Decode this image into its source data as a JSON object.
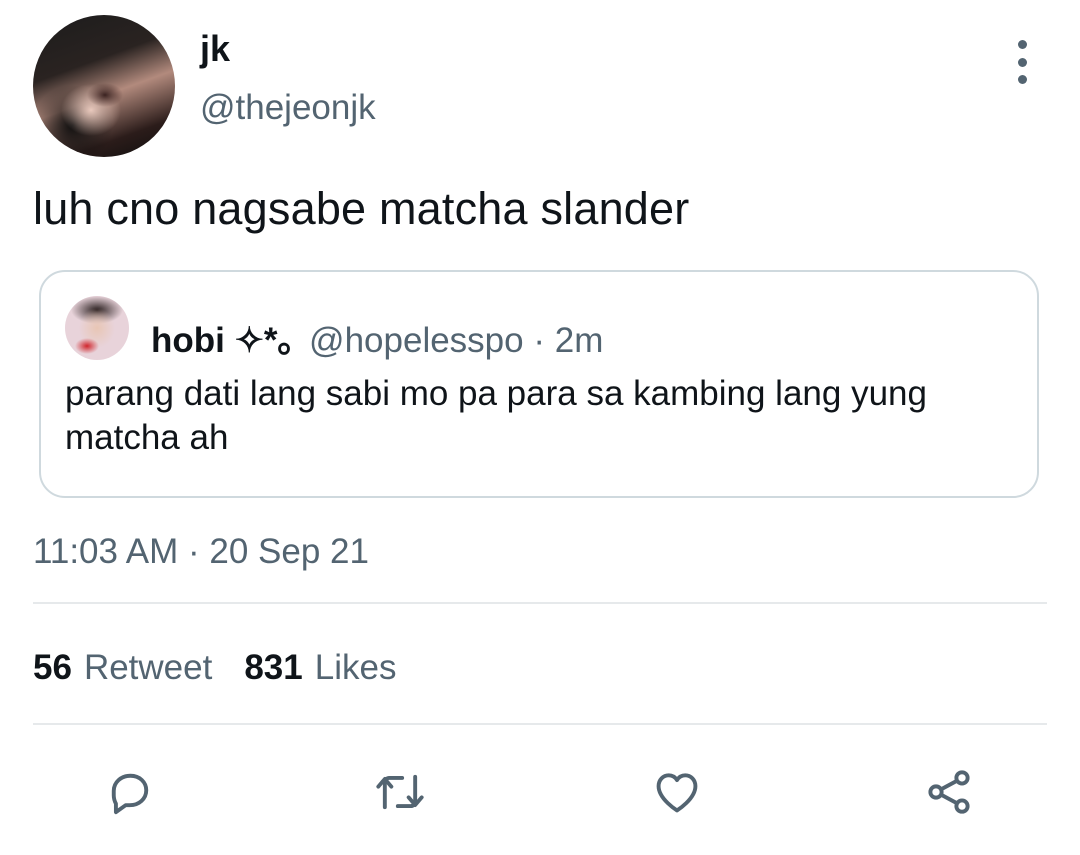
{
  "author": {
    "name": "jk",
    "handle": "@thejeonjk"
  },
  "tweet": {
    "text": "luh cno nagsabe matcha slander",
    "timestamp": "11:03 AM · 20 Sep 21"
  },
  "quoted_tweet": {
    "name": "hobi ✧*｡",
    "handle": "@hopelesspo",
    "time": " · 2m",
    "text": "parang dati lang sabi mo pa para sa kambing lang yung matcha ah"
  },
  "stats": {
    "retweets_count": "56",
    "retweets_label": "Retweet",
    "likes_count": "831",
    "likes_label": "Likes"
  },
  "actions": {
    "reply_icon": "reply-icon",
    "retweet_icon": "retweet-icon",
    "like_icon": "heart-icon",
    "share_icon": "share-icon"
  },
  "colors": {
    "text_primary": "#0f1419",
    "text_secondary": "#536471",
    "border": "#cfd9de",
    "divider": "#e6e9eb"
  }
}
